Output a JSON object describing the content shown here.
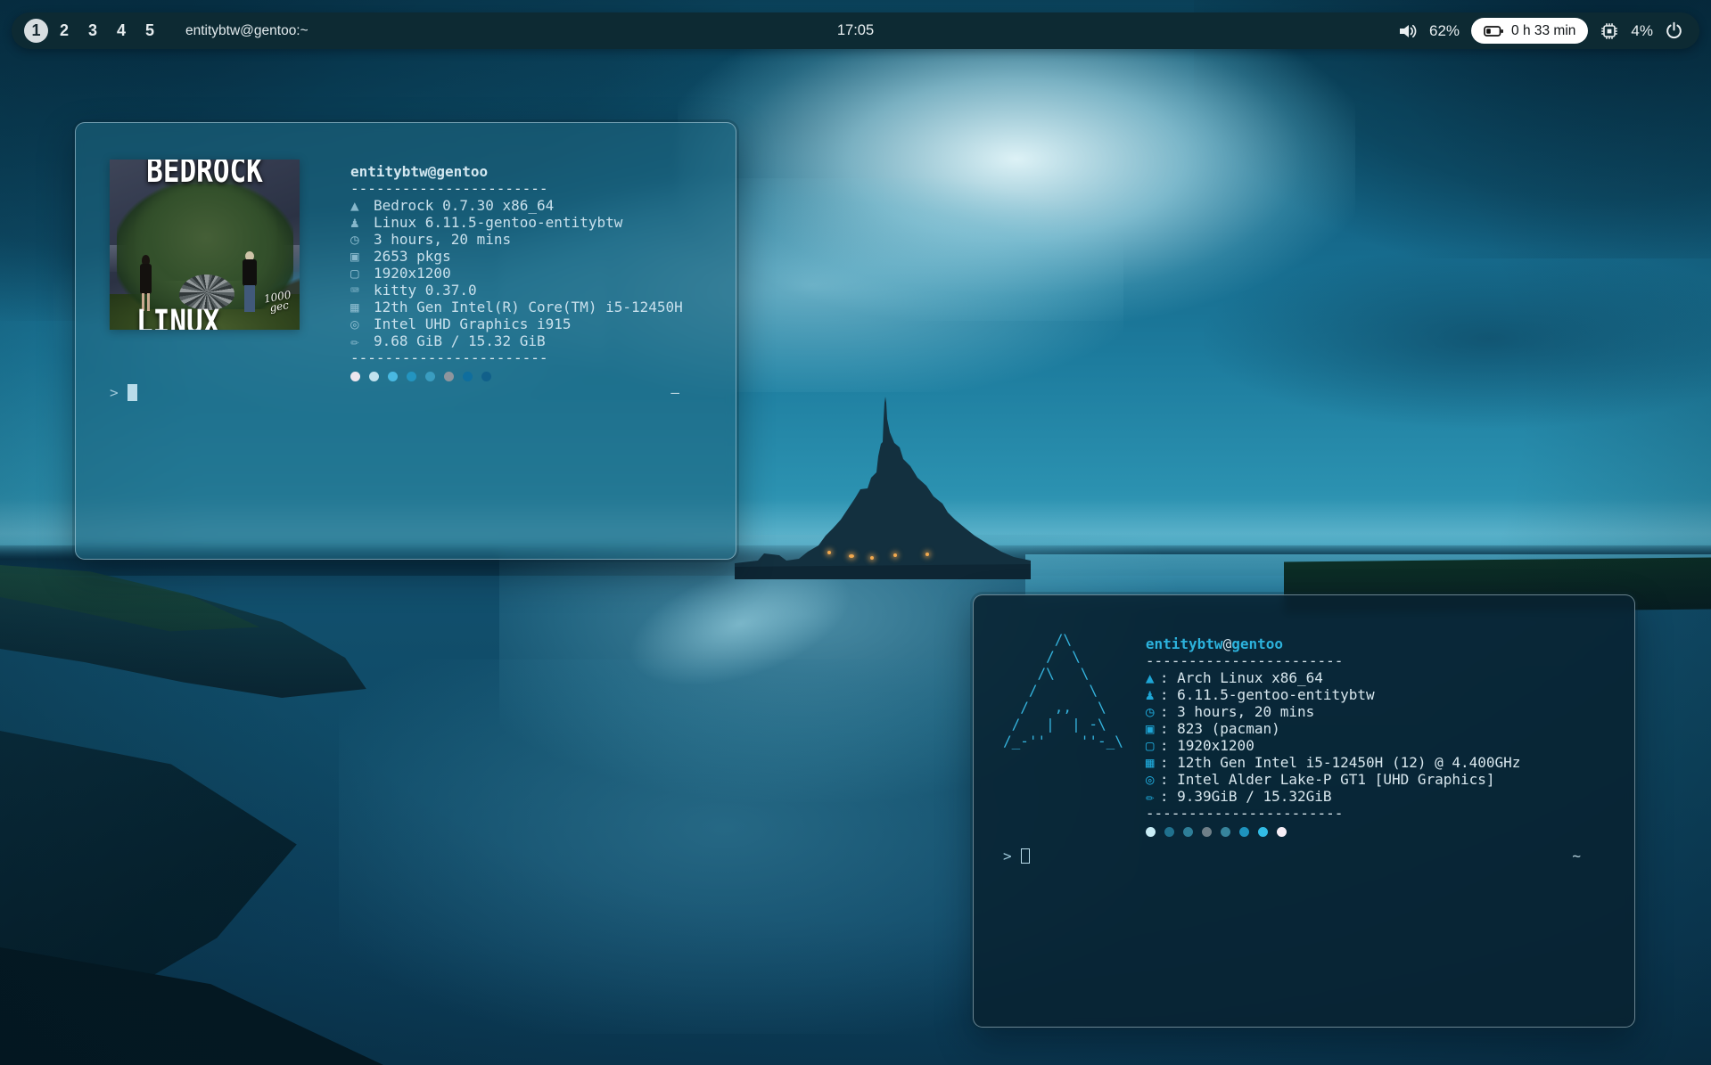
{
  "colors": {
    "bar_bg": "#0d2a33",
    "accent_cyan": "#2cb2dc",
    "terminal1_text": "#c8e0ec",
    "terminal2_text": "#d8e7ee",
    "light_color": "#f2a94e"
  },
  "bar": {
    "workspaces": [
      {
        "label": "1",
        "active": true
      },
      {
        "label": "2",
        "active": false
      },
      {
        "label": "3",
        "active": false
      },
      {
        "label": "4",
        "active": false
      },
      {
        "label": "5",
        "active": false
      }
    ],
    "window_title": "entitybtw@gentoo:~",
    "clock": "17:05",
    "volume": "62%",
    "battery_time": "0 h 33 min",
    "cpu_usage": "4%",
    "icons": [
      "volume-icon",
      "battery-icon",
      "cpu-chip-icon",
      "power-icon"
    ]
  },
  "terminal1": {
    "title_user": "entitybtw",
    "title_at": "@",
    "title_host": "gentoo",
    "separator": "-----------------------",
    "sep": "",
    "lines": [
      {
        "icon_name": "mountain-icon",
        "glyph": "▲",
        "text": "Bedrock 0.7.30 x86_64"
      },
      {
        "icon_name": "penguin-icon",
        "glyph": "♟",
        "text": "Linux 6.11.5-gentoo-entitybtw"
      },
      {
        "icon_name": "clock-icon",
        "glyph": "◷",
        "text": "3 hours, 20 mins"
      },
      {
        "icon_name": "package-icon",
        "glyph": "▣",
        "text": "2653 pkgs"
      },
      {
        "icon_name": "display-icon",
        "glyph": "▢",
        "text": "1920x1200"
      },
      {
        "icon_name": "terminal-icon",
        "glyph": "⌨",
        "text": "kitty 0.37.0"
      },
      {
        "icon_name": "cpu-icon",
        "glyph": "▦",
        "text": "12th Gen Intel(R) Core(TM) i5-12450H"
      },
      {
        "icon_name": "gpu-icon",
        "glyph": "◎",
        "text": "Intel UHD Graphics i915"
      },
      {
        "icon_name": "memory-icon",
        "glyph": "✏",
        "text": "9.68 GiB / 15.32 GiB"
      }
    ],
    "palette": [
      "#eee6ee",
      "#c2e2ee",
      "#49b9e2",
      "#2394c0",
      "#3a9dc0",
      "#8e959d",
      "#0f6e9e",
      "#11608a"
    ],
    "prompt_char": ">",
    "right_prompt": "–",
    "logo": {
      "title_top": "BEDROCK",
      "title_bottom": "LINUX",
      "credit_line1": "1000",
      "credit_line2": "gec"
    }
  },
  "terminal2": {
    "title_user": "entitybtw",
    "title_at": "@",
    "title_host": "gentoo",
    "separator": "-----------------------",
    "sep": ": ",
    "ascii_logo": [
      "      /\\",
      "     /  \\",
      "    /\\   \\",
      "   /      \\",
      "  /   ,,   \\",
      " /   |  | -\\",
      "/_-''    ''-_\\"
    ],
    "lines": [
      {
        "icon_name": "mountain-icon",
        "glyph": "▲",
        "text": "Arch Linux x86_64"
      },
      {
        "icon_name": "penguin-icon",
        "glyph": "♟",
        "text": "6.11.5-gentoo-entitybtw"
      },
      {
        "icon_name": "clock-icon",
        "glyph": "◷",
        "text": "3 hours, 20 mins"
      },
      {
        "icon_name": "package-icon",
        "glyph": "▣",
        "text": "823 (pacman)"
      },
      {
        "icon_name": "display-icon",
        "glyph": "▢",
        "text": "1920x1200"
      },
      {
        "icon_name": "cpu-icon",
        "glyph": "▦",
        "text": "12th Gen Intel i5-12450H (12) @ 4.400GHz"
      },
      {
        "icon_name": "gpu-icon",
        "glyph": "◎",
        "text": "Intel Alder Lake-P GT1 [UHD Graphics]"
      },
      {
        "icon_name": "memory-icon",
        "glyph": "✏",
        "text": "9.39GiB / 15.32GiB"
      }
    ],
    "palette": [
      "#c9edf6",
      "#20718e",
      "#2e7e98",
      "#6f7f88",
      "#37849c",
      "#1e93be",
      "#32bce6",
      "#f6eef6"
    ],
    "prompt_char": ">",
    "right_prompt": "~"
  }
}
